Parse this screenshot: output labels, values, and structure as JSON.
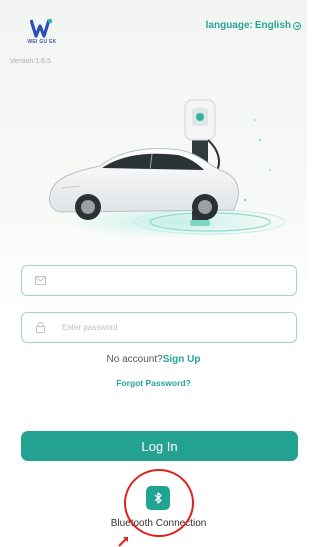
{
  "brand": {
    "logo_text": "WEI GU EK",
    "version": "Version:1.6.5"
  },
  "language": {
    "label": "language:",
    "value": "English"
  },
  "form": {
    "username_placeholder": "",
    "password_placeholder": "Enter password"
  },
  "account": {
    "prompt": "No account?",
    "signup": "Sign Up"
  },
  "forgot": "Forgot Password?",
  "login_label": "Log In",
  "bluetooth": {
    "label": "Bluetooth Connection"
  },
  "colors": {
    "accent": "#23a191",
    "highlight_circle": "#e0221f"
  }
}
